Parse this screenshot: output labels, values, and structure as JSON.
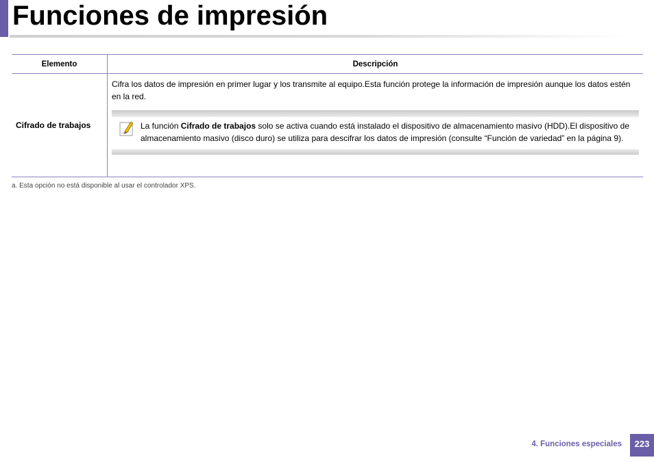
{
  "page": {
    "title": "Funciones de impresión"
  },
  "table": {
    "headers": [
      "Elemento",
      "Descripción"
    ],
    "rows": [
      {
        "element": "Cifrado de trabajos",
        "description": "Cifra los datos de impresión en primer lugar y los transmite al equipo.Esta función protege la información de impresión aunque los datos estén en la red.",
        "note": {
          "prefix": "La función ",
          "bold": "Cifrado de trabajos",
          "suffix": " solo se activa cuando está instalado el dispositivo de almacenamiento masivo (HDD).El dispositivo de almacenamiento masivo (disco duro) se utiliza para descifrar los datos de impresión (consulte “Función de variedad” en la página 9)."
        }
      }
    ]
  },
  "footnote": "a. Esta opción no está disponible al usar el controlador XPS.",
  "footer": {
    "section": "4.  Funciones especiales",
    "page_number": "223"
  },
  "icons": {
    "note": "note-pencil-icon"
  },
  "colors": {
    "accent": "#6a5ea8",
    "rule": "#8a83bd"
  }
}
